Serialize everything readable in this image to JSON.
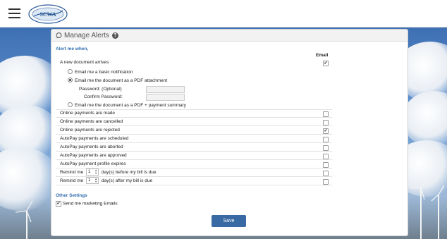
{
  "header": {
    "menu_icon": "hamburger-icon",
    "logo": {
      "top_text": "SUFFOLK COUNTY",
      "main_text": "SCWA",
      "bottom_text": "WATER AUTHORITY"
    }
  },
  "panel": {
    "title": "Manage Alerts",
    "help_icon": "question-icon",
    "header_icon": "chat-bubble-icon"
  },
  "alerts": {
    "section_title": "Alert me when,",
    "column_email": "Email",
    "new_document": {
      "label": "A new document arrives",
      "checked": true
    },
    "options": {
      "basic": "Email me a basic notification",
      "pdf": "Email me the document as a PDF attachment",
      "password_label": "Password: (Optional)",
      "confirm_label": "Confirm Password:",
      "pdf_summary": "Email me the document as a PDF + payment summary",
      "selected": "pdf"
    },
    "items": [
      {
        "label": "Online payments are made",
        "checked": false
      },
      {
        "label": "Online payments are cancelled",
        "checked": false
      },
      {
        "label": "Online payments are rejected",
        "checked": true
      },
      {
        "label": "AutoPay payments are scheduled",
        "checked": false
      },
      {
        "label": "AutoPay payments are aborted",
        "checked": false
      },
      {
        "label": "AutoPay payments are approved",
        "checked": false
      },
      {
        "label": "AutoPay payment profile expires",
        "checked": false
      }
    ],
    "remind_before": {
      "prefix": "Remind me",
      "value": "1",
      "suffix": "day(s) before my bill is due",
      "checked": false
    },
    "remind_after": {
      "prefix": "Remind me",
      "value": "1",
      "suffix": "day(s) after my bill is due",
      "checked": false
    }
  },
  "other": {
    "section_title": "Other Settings",
    "marketing": {
      "label": "Send me marketing Emails",
      "checked": true
    }
  },
  "save_label": "Save",
  "colors": {
    "accent": "#2f6db0",
    "button": "#3a6aa3",
    "sky_top": "#3d6fb3"
  }
}
